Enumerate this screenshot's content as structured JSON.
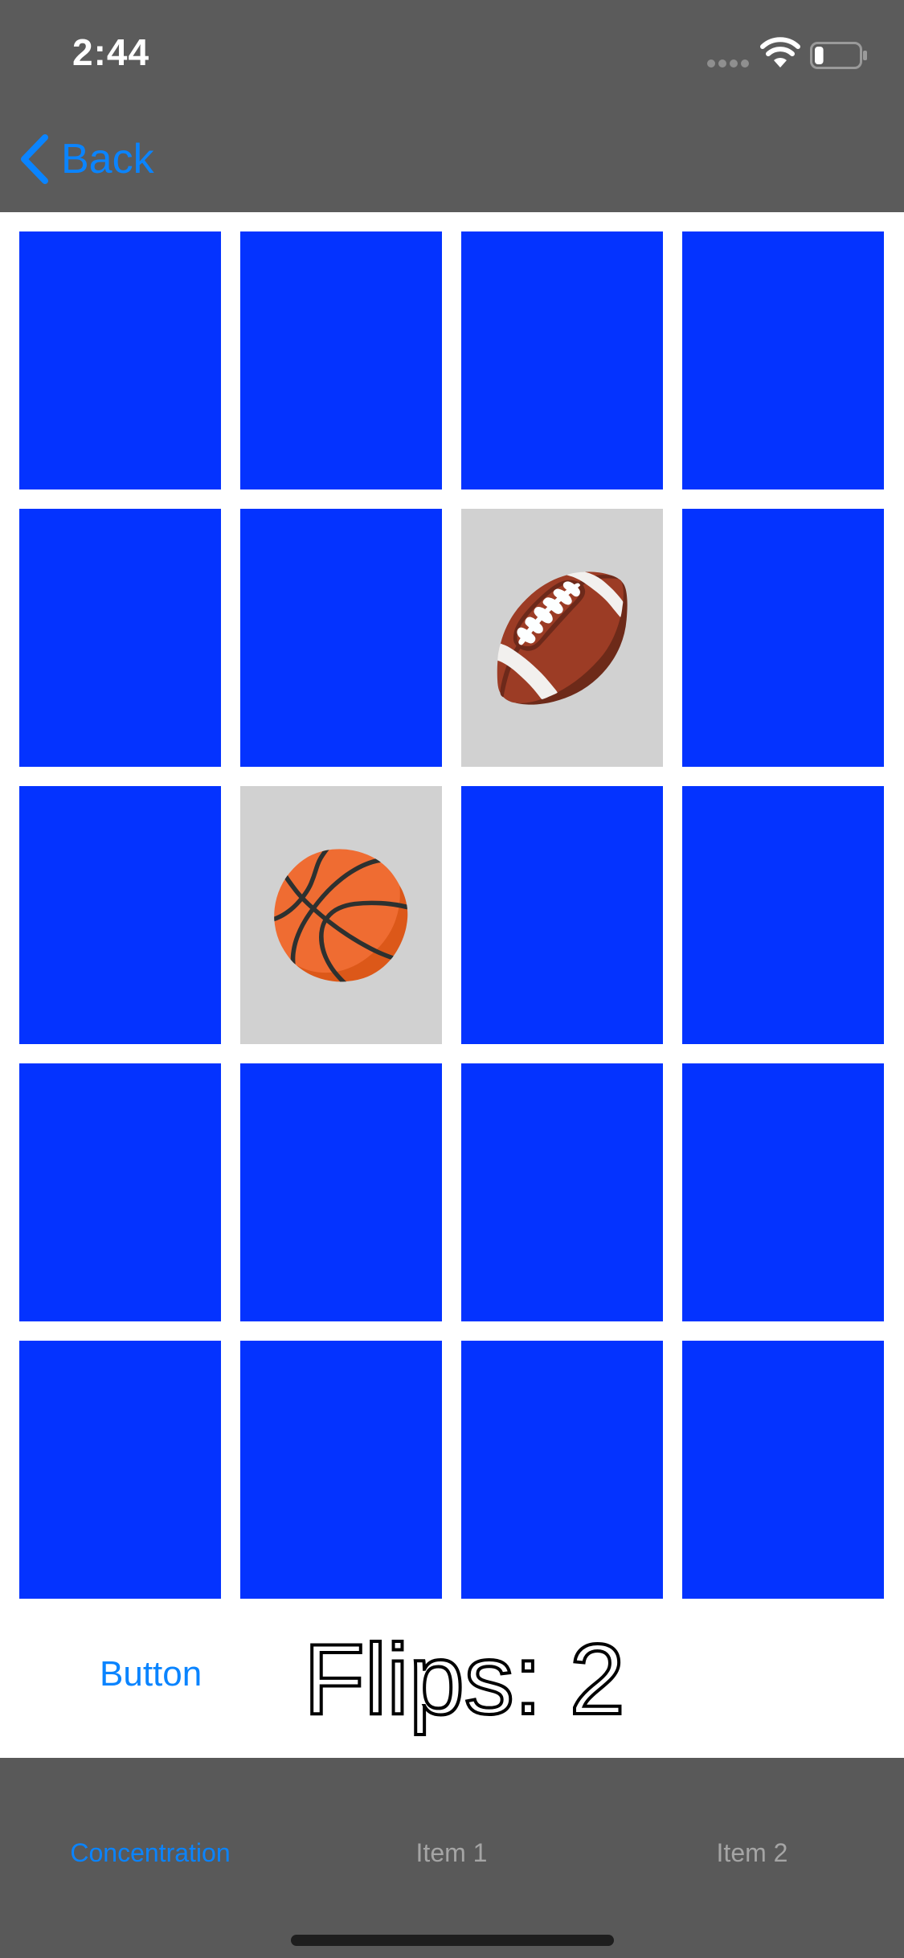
{
  "status_bar": {
    "time": "2:44",
    "signal_icon": "signal-dots-icon",
    "wifi_icon": "wifi-icon",
    "battery_icon": "battery-icon",
    "battery_level_fraction": 0.2
  },
  "nav_bar": {
    "back_label": "Back",
    "back_icon": "chevron-left-icon"
  },
  "grid": {
    "columns": 4,
    "rows": 5,
    "card_back_color": "#0433ff",
    "card_face_color": "#d1d1d1",
    "cards": [
      {
        "face_up": false,
        "emoji": ""
      },
      {
        "face_up": false,
        "emoji": ""
      },
      {
        "face_up": false,
        "emoji": ""
      },
      {
        "face_up": false,
        "emoji": ""
      },
      {
        "face_up": false,
        "emoji": ""
      },
      {
        "face_up": false,
        "emoji": ""
      },
      {
        "face_up": true,
        "emoji": "🏈",
        "icon": "football-icon"
      },
      {
        "face_up": false,
        "emoji": ""
      },
      {
        "face_up": false,
        "emoji": ""
      },
      {
        "face_up": true,
        "emoji": "🏀",
        "icon": "basketball-icon"
      },
      {
        "face_up": false,
        "emoji": ""
      },
      {
        "face_up": false,
        "emoji": ""
      },
      {
        "face_up": false,
        "emoji": ""
      },
      {
        "face_up": false,
        "emoji": ""
      },
      {
        "face_up": false,
        "emoji": ""
      },
      {
        "face_up": false,
        "emoji": ""
      },
      {
        "face_up": false,
        "emoji": ""
      },
      {
        "face_up": false,
        "emoji": ""
      },
      {
        "face_up": false,
        "emoji": ""
      },
      {
        "face_up": false,
        "emoji": ""
      }
    ]
  },
  "controls": {
    "button_label": "Button",
    "flips_text": "Flips: 2"
  },
  "tab_bar": {
    "tabs": [
      {
        "label": "Concentration",
        "active": true
      },
      {
        "label": "Item 1",
        "active": false
      },
      {
        "label": "Item 2",
        "active": false
      }
    ],
    "active_color": "#0a84ff",
    "inactive_color": "#a5a5a5"
  },
  "colors": {
    "top_bar": "#5b5b5b",
    "tab_bar": "#595959",
    "accent": "#0a84ff"
  }
}
